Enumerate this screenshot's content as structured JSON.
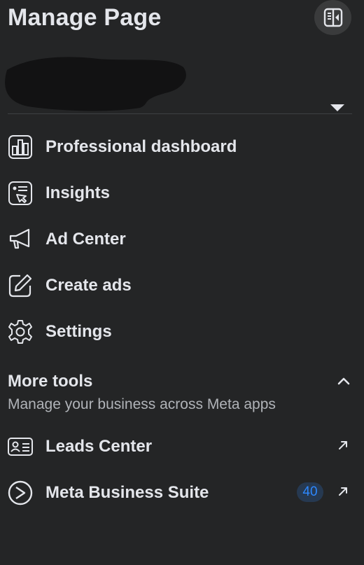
{
  "header": {
    "title": "Manage Page"
  },
  "nav": {
    "items": [
      {
        "label": "Professional dashboard",
        "icon": "dashboard-icon"
      },
      {
        "label": "Insights",
        "icon": "insights-icon"
      },
      {
        "label": "Ad Center",
        "icon": "megaphone-icon"
      },
      {
        "label": "Create ads",
        "icon": "edit-icon"
      },
      {
        "label": "Settings",
        "icon": "gear-icon"
      }
    ]
  },
  "more_tools": {
    "title": "More tools",
    "subtitle": "Manage your business across Meta apps",
    "items": [
      {
        "label": "Leads Center",
        "icon": "contact-card-icon"
      },
      {
        "label": "Meta Business Suite",
        "icon": "meta-business-suite-icon",
        "badge": "40"
      }
    ]
  },
  "colors": {
    "background": "#242526",
    "text_primary": "#e4e6eb",
    "text_secondary": "#b0b3b8",
    "badge_bg": "#263951",
    "badge_text": "#2d88ff"
  }
}
